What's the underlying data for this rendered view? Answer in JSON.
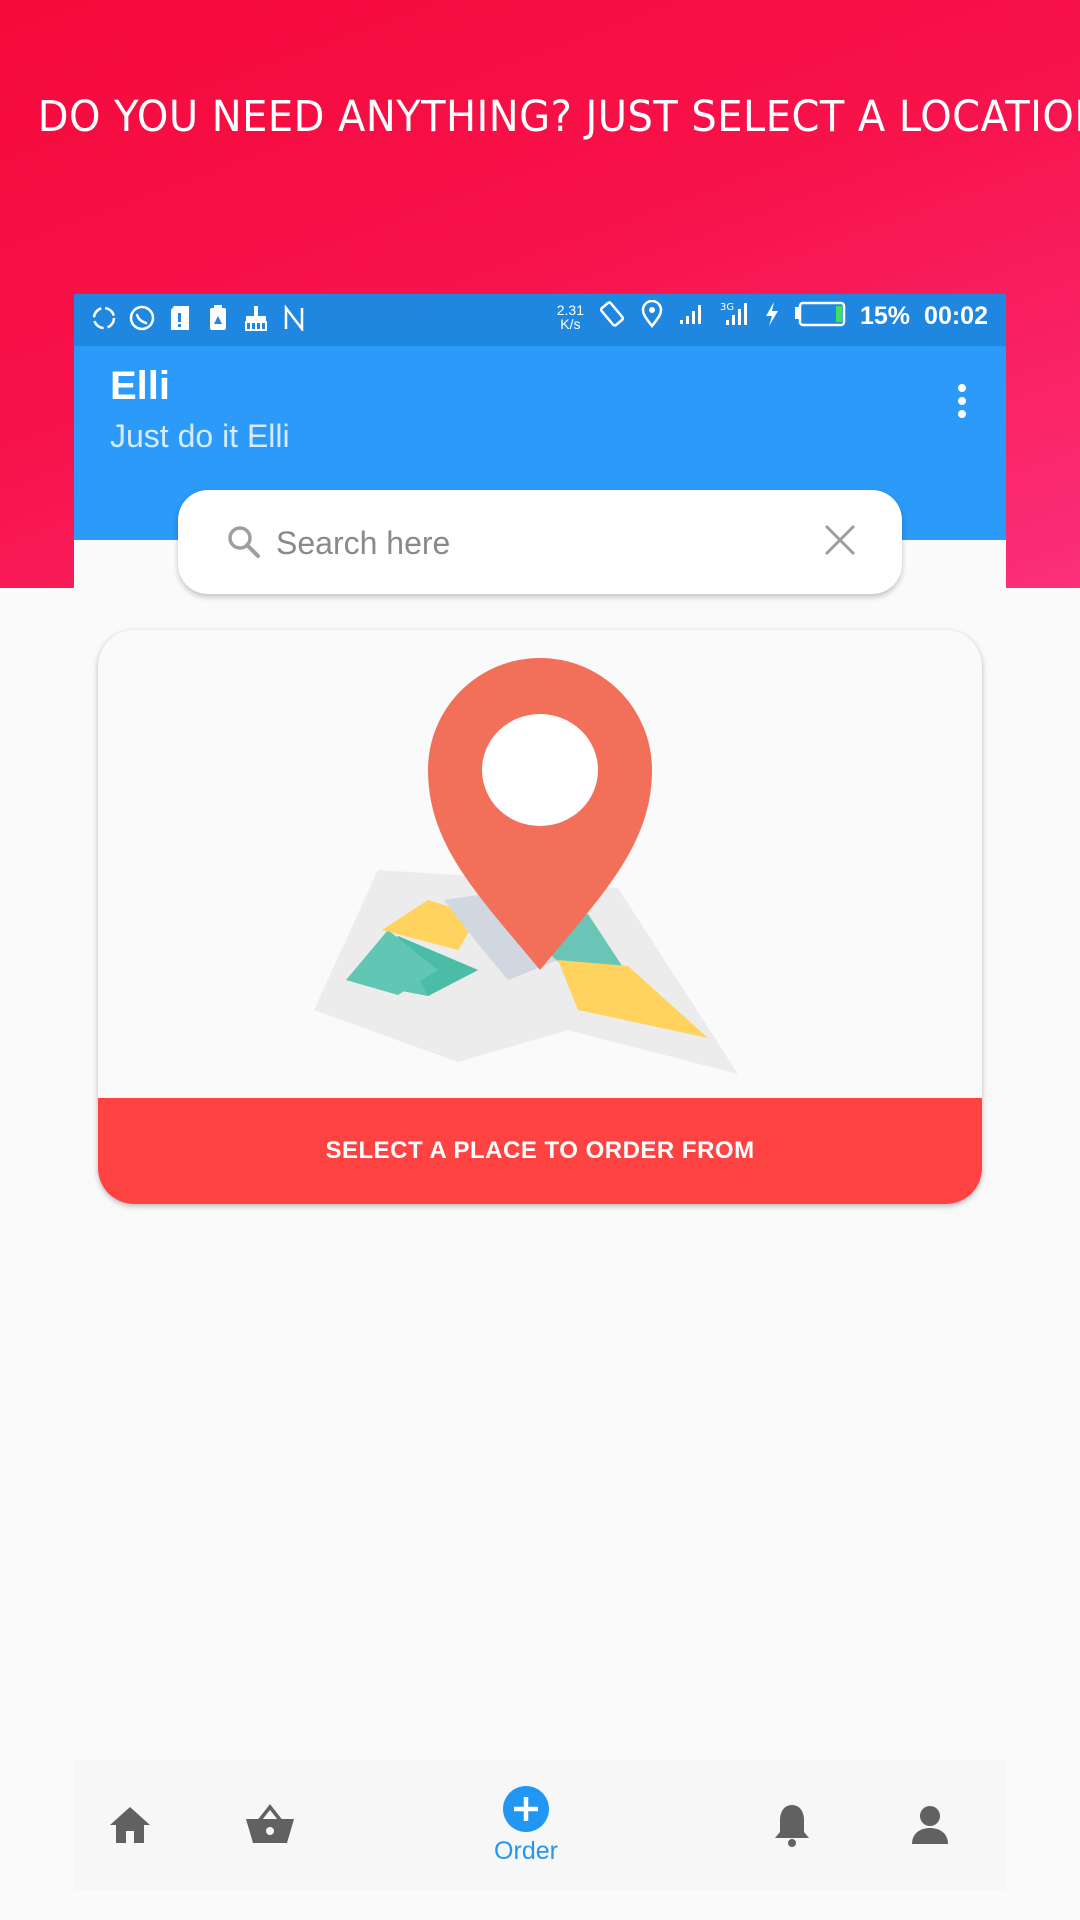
{
  "promo": {
    "title": "DO YOU NEED ANYTHING? JUST SELECT A LOCATION"
  },
  "status_bar": {
    "left_icons": [
      "sync-icon",
      "whatsapp-icon",
      "sd-card-icon",
      "storage-icon",
      "cleaner-icon",
      "n-icon"
    ],
    "net_speed_value": "2.31",
    "net_speed_unit": "K/s",
    "right_icons": [
      "rotate-icon",
      "location-icon",
      "signal-icon",
      "signal-4g-icon",
      "charging-icon",
      "battery-icon"
    ],
    "battery": "15%",
    "time": "00:02"
  },
  "app_bar": {
    "title": "Elli",
    "subtitle": "Just do it Elli"
  },
  "search": {
    "placeholder": "Search here",
    "value": ""
  },
  "card": {
    "button_label": "SELECT A PLACE TO ORDER FROM"
  },
  "bottom_nav": {
    "items": [
      {
        "icon": "home-icon",
        "label": ""
      },
      {
        "icon": "basket-icon",
        "label": ""
      },
      {
        "icon": "add-circle-icon",
        "label": "Order"
      },
      {
        "icon": "bell-icon",
        "label": ""
      },
      {
        "icon": "person-icon",
        "label": ""
      }
    ],
    "active_color": "#2196f3",
    "inactive_color": "#616161"
  },
  "colors": {
    "promo_gradient_start": "#f50a3b",
    "promo_gradient_end": "#fb2f7a",
    "status_bar": "#1f87e0",
    "app_bar": "#2b9af8",
    "card_button": "#ff4242",
    "pin": "#f2705a"
  }
}
